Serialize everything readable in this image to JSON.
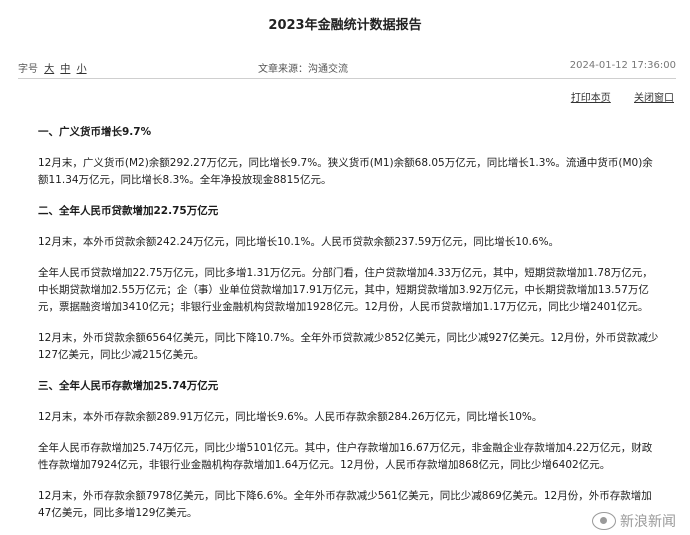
{
  "title": "2023年金融统计数据报告",
  "meta": {
    "font_size_label": "字号",
    "size_large": "大",
    "size_medium": "中",
    "size_small": "小",
    "source": "文章来源：沟通交流",
    "date": "2024-01-12 17:36:00"
  },
  "actions": {
    "print": "打印本页",
    "close": "关闭窗口"
  },
  "sections": [
    {
      "heading": "一、广义货币增长9.7%",
      "paragraphs": [
        "12月末，广义货币(M2)余额292.27万亿元，同比增长9.7%。狭义货币(M1)余额68.05万亿元，同比增长1.3%。流通中货币(M0)余额11.34万亿元，同比增长8.3%。全年净投放现金8815亿元。"
      ]
    },
    {
      "heading": "二、全年人民币贷款增加22.75万亿元",
      "paragraphs": [
        "12月末，本外币贷款余额242.24万亿元，同比增长10.1%。人民币贷款余额237.59万亿元，同比增长10.6%。",
        "全年人民币贷款增加22.75万亿元，同比多增1.31万亿元。分部门看，住户贷款增加4.33万亿元，其中，短期贷款增加1.78万亿元，中长期贷款增加2.55万亿元；企（事）业单位贷款增加17.91万亿元，其中，短期贷款增加3.92万亿元，中长期贷款增加13.57万亿元，票据融资增加3410亿元；非银行业金融机构贷款增加1928亿元。12月份，人民币贷款增加1.17万亿元，同比少增2401亿元。",
        "12月末，外币贷款余额6564亿美元，同比下降10.7%。全年外币贷款减少852亿美元，同比少减927亿美元。12月份，外币贷款减少127亿美元，同比少减215亿美元。"
      ]
    },
    {
      "heading": "三、全年人民币存款增加25.74万亿元",
      "paragraphs": [
        "12月末，本外币存款余额289.91万亿元，同比增长9.6%。人民币存款余额284.26万亿元，同比增长10%。",
        "全年人民币存款增加25.74万亿元，同比少增5101亿元。其中，住户存款增加16.67万亿元，非金融企业存款增加4.22万亿元，财政性存款增加7924亿元，非银行业金融机构存款增加1.64万亿元。12月份，人民币存款增加868亿元，同比少增6402亿元。",
        "12月末，外币存款余额7978亿美元，同比下降6.6%。全年外币存款减少561亿美元，同比少减869亿美元。12月份，外币存款增加47亿美元，同比多增129亿美元。"
      ]
    }
  ],
  "watermark": "新浪新闻",
  "icons": {
    "watermark": "eye-icon"
  }
}
